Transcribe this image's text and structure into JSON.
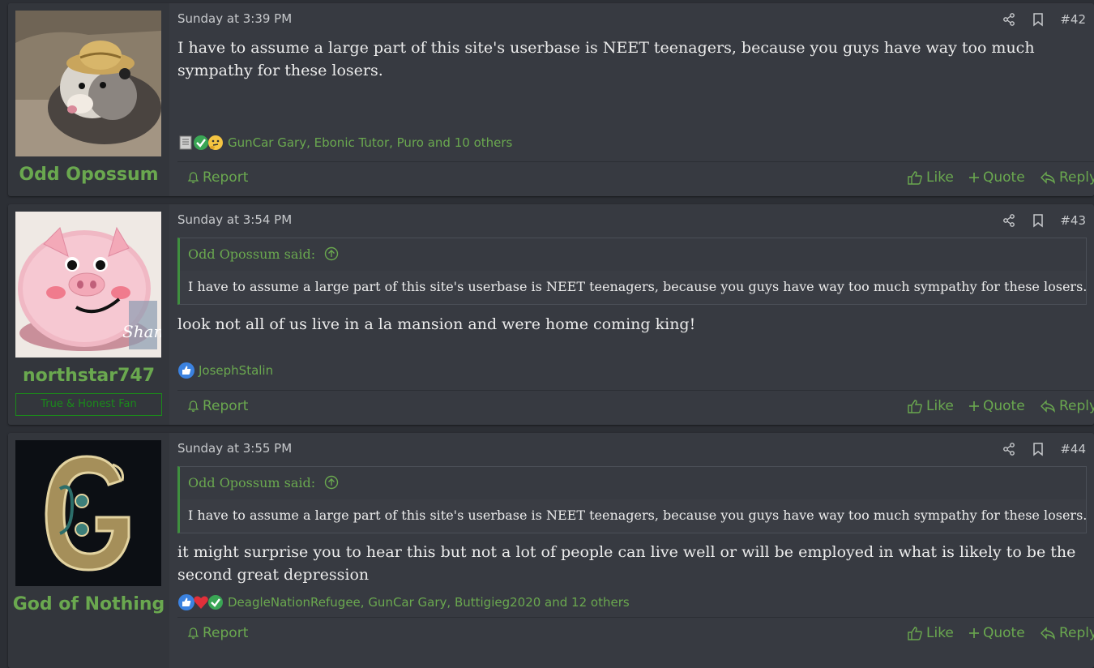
{
  "posts": [
    {
      "username": "Odd Opossum",
      "usertitle": "",
      "date": "Sunday at 3:39 PM",
      "number": "#42",
      "quote": null,
      "body": "I have to assume a large part of this site's userbase is NEET teenagers, because you guys have way too much sympathy for these losers.",
      "reactions_text": "GunCar Gary, Ebonic Tutor, Puro and 10 others",
      "reaction_icons": [
        "newspaper-icon",
        "checkmark-icon",
        "thinking-face-icon"
      ]
    },
    {
      "username": "northstar747",
      "usertitle": "True & Honest Fan",
      "date": "Sunday at 3:54 PM",
      "number": "#43",
      "quote": {
        "author": "Odd Opossum said:",
        "text": "I have to assume a large part of this site's userbase is NEET teenagers, because you guys have way too much sympathy for these losers."
      },
      "body": "look not all of us live in a la mansion and were home coming king!",
      "reactions_text": "JosephStalin",
      "reaction_icons": [
        "thumbs-up-icon"
      ]
    },
    {
      "username": "God of Nothing",
      "usertitle": "",
      "date": "Sunday at 3:55 PM",
      "number": "#44",
      "quote": {
        "author": "Odd Opossum said:",
        "text": "I have to assume a large part of this site's userbase is NEET teenagers, because you guys have way too much sympathy for these losers."
      },
      "body": "it might surprise you to hear this but not a lot of people can live well or will be employed in what is likely to be the second great depression",
      "reactions_text": "DeagleNationRefugee, GunCar Gary, Buttigieg2020 and 12 others",
      "reaction_icons": [
        "thumbs-up-icon",
        "heart-icon",
        "checkmark-icon"
      ]
    }
  ],
  "actions": {
    "report": "Report",
    "like": "Like",
    "quote": "Quote",
    "reply": "Reply"
  },
  "colors": {
    "accent_green": "#6aa84f",
    "post_bg": "#373a41",
    "page_bg": "#2c2f35"
  }
}
